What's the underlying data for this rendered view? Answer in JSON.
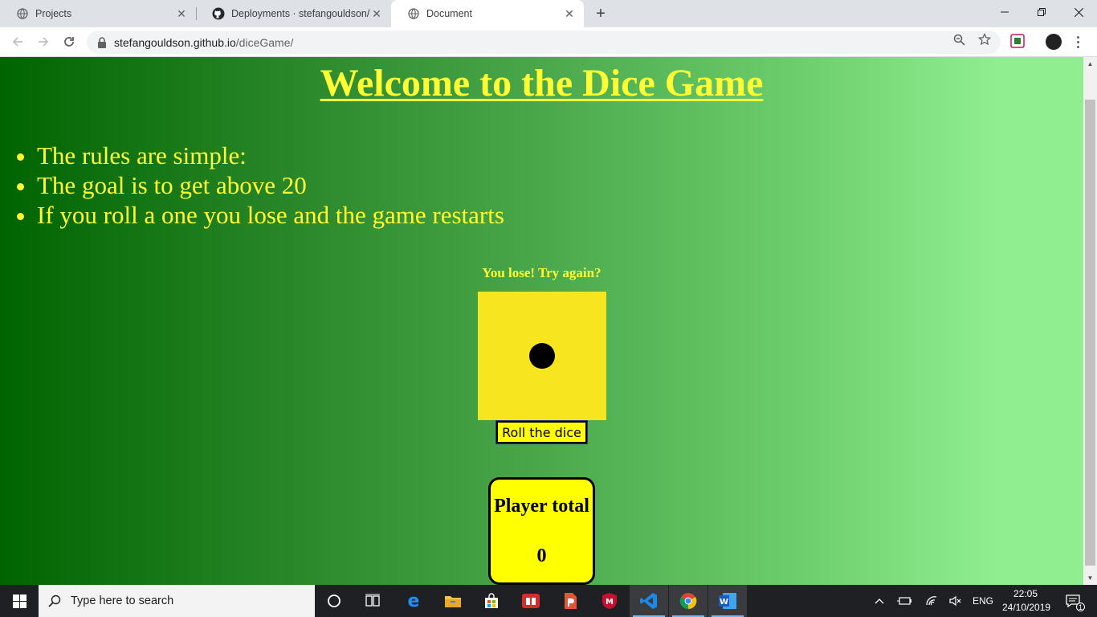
{
  "browser": {
    "tabs": [
      {
        "title": "Projects",
        "icon": "globe-icon",
        "active": false
      },
      {
        "title": "Deployments · stefangouldson/d",
        "icon": "github-icon",
        "active": false
      },
      {
        "title": "Document",
        "icon": "globe-icon",
        "active": true
      }
    ],
    "address": {
      "host": "stefangouldson.github.io",
      "path": "/diceGame/"
    }
  },
  "page": {
    "title": "Welcome to the Dice Game",
    "rules": [
      "The rules are simple:",
      "The goal is to get above 20",
      "If you roll a one you lose and the game restarts"
    ],
    "status": "You lose! Try again?",
    "die_value": 1,
    "roll_button": "Roll the dice",
    "player_total_label": "Player total",
    "player_total_value": "0",
    "colors": {
      "text_accent": "#ffff33",
      "die_face": "#f7e51f",
      "gradient_start": "#006400",
      "gradient_end": "#90ee90"
    }
  },
  "taskbar": {
    "search_placeholder": "Type here to search",
    "language": "ENG",
    "time": "22:05",
    "date": "24/10/2019",
    "notifications": "1"
  }
}
